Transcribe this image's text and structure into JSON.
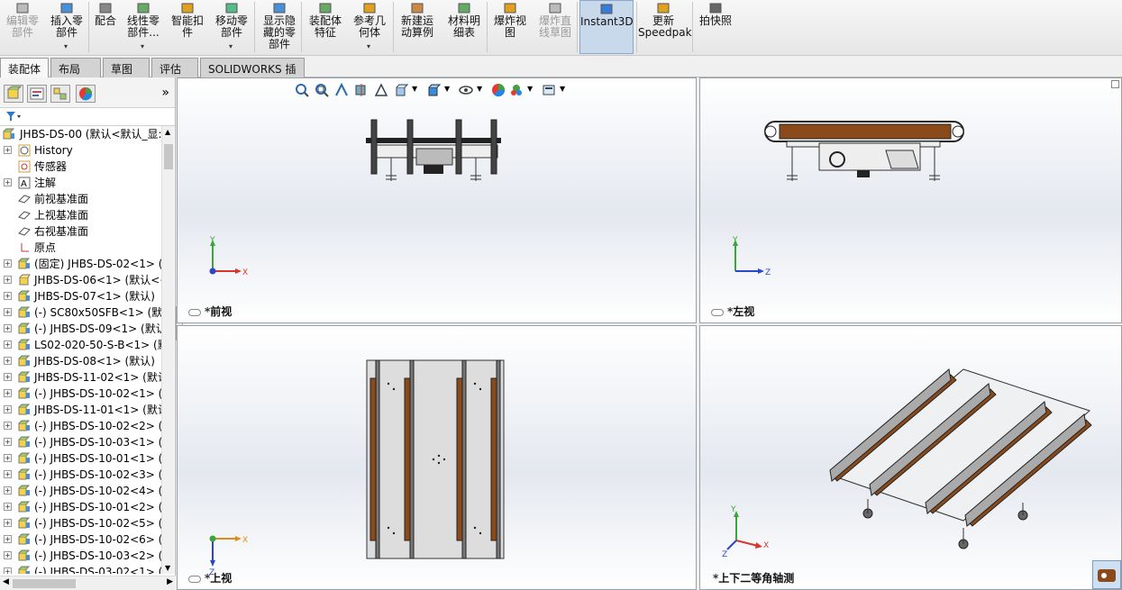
{
  "ribbon": {
    "buttons": [
      {
        "label": "编辑零\n部件",
        "name": "edit-component-button",
        "disabled": true
      },
      {
        "label": "插入零\n部件",
        "name": "insert-components-button"
      },
      {
        "label": "配合",
        "name": "mate-button"
      },
      {
        "label": "线性零\n部件...",
        "name": "linear-pattern-button"
      },
      {
        "label": "智能扣\n件",
        "name": "smart-fasteners-button"
      },
      {
        "label": "移动零\n部件",
        "name": "move-component-button"
      },
      {
        "label": "显示隐\n藏的零\n部件",
        "name": "show-hidden-components-button"
      },
      {
        "label": "装配体\n特征",
        "name": "assembly-features-button"
      },
      {
        "label": "参考几\n何体",
        "name": "reference-geometry-button"
      },
      {
        "label": "新建运\n动算例",
        "name": "new-motion-study-button"
      },
      {
        "label": "材料明\n细表",
        "name": "bill-of-materials-button"
      },
      {
        "label": "爆炸视\n图",
        "name": "exploded-view-button"
      },
      {
        "label": "爆炸直\n线草图",
        "name": "explode-line-sketch-button",
        "disabled": true
      },
      {
        "label": "Instant3D",
        "name": "instant3d-button",
        "active": true
      },
      {
        "label": "更新\nSpeedpak",
        "name": "update-speedpak-button"
      },
      {
        "label": "拍快照",
        "name": "take-snapshot-button"
      }
    ]
  },
  "tabs": [
    "装配体",
    "布局",
    "草图",
    "评估",
    "SOLIDWORKS 插件"
  ],
  "tree": {
    "root": "JHBS-DS-00  (默认<默认_显:",
    "items": [
      {
        "label": "History",
        "icon": "history-icon",
        "exp": true
      },
      {
        "label": "传感器",
        "icon": "sensor-icon",
        "exp": false
      },
      {
        "label": "注解",
        "icon": "annotation-icon",
        "exp": true
      },
      {
        "label": "前视基准面",
        "icon": "plane-icon",
        "exp": false
      },
      {
        "label": "上视基准面",
        "icon": "plane-icon",
        "exp": false
      },
      {
        "label": "右视基准面",
        "icon": "plane-icon",
        "exp": false
      },
      {
        "label": "原点",
        "icon": "origin-icon",
        "exp": false
      },
      {
        "label": "(固定) JHBS-DS-02<1> (",
        "icon": "subassembly-icon",
        "exp": true
      },
      {
        "label": "JHBS-DS-06<1> (默认<<",
        "icon": "part-icon",
        "exp": true
      },
      {
        "label": "JHBS-DS-07<1> (默认)",
        "icon": "subassembly-icon",
        "exp": true
      },
      {
        "label": "(-) SC80x50SFB<1> (默认",
        "icon": "subassembly-icon",
        "exp": true
      },
      {
        "label": "(-) JHBS-DS-09<1> (默认",
        "icon": "subassembly-icon",
        "exp": true
      },
      {
        "label": "LS02-020-50-S-B<1> (默",
        "icon": "subassembly-icon",
        "exp": true
      },
      {
        "label": "JHBS-DS-08<1> (默认)",
        "icon": "subassembly-icon",
        "exp": true
      },
      {
        "label": "JHBS-DS-11-02<1> (默认",
        "icon": "subassembly-icon",
        "exp": true
      },
      {
        "label": "(-) JHBS-DS-10-02<1> (",
        "icon": "subassembly-icon",
        "exp": true
      },
      {
        "label": "JHBS-DS-11-01<1> (默认",
        "icon": "subassembly-icon",
        "exp": true
      },
      {
        "label": "(-) JHBS-DS-10-02<2> (",
        "icon": "subassembly-icon",
        "exp": true
      },
      {
        "label": "(-) JHBS-DS-10-03<1> (",
        "icon": "subassembly-icon",
        "exp": true
      },
      {
        "label": "(-) JHBS-DS-10-01<1> (",
        "icon": "subassembly-icon",
        "exp": true
      },
      {
        "label": "(-) JHBS-DS-10-02<3> (",
        "icon": "subassembly-icon",
        "exp": true
      },
      {
        "label": "(-) JHBS-DS-10-02<4> (",
        "icon": "subassembly-icon",
        "exp": true
      },
      {
        "label": "(-) JHBS-DS-10-01<2> (",
        "icon": "subassembly-icon",
        "exp": true
      },
      {
        "label": "(-) JHBS-DS-10-02<5> (",
        "icon": "subassembly-icon",
        "exp": true
      },
      {
        "label": "(-) JHBS-DS-10-02<6> (",
        "icon": "subassembly-icon",
        "exp": true
      },
      {
        "label": "(-) JHBS-DS-10-03<2> (",
        "icon": "subassembly-icon",
        "exp": true
      },
      {
        "label": "(-) JHBS-DS-03-02<1> (",
        "icon": "subassembly-icon",
        "exp": true
      }
    ]
  },
  "viewports": {
    "front": "*前视",
    "left": "*左视",
    "top": "*上视",
    "iso": "*上下二等角轴测"
  },
  "axes": {
    "x": "X",
    "y": "Y",
    "z": "Z"
  },
  "panel_collapse": "»",
  "colors": {
    "accent_active": "#c9d9ec",
    "belt_brown": "#8b4a1a",
    "axis_x": "#d9362b",
    "axis_y": "#3aa53a",
    "axis_z": "#2b47c9",
    "axis_orange": "#e08a1e"
  }
}
